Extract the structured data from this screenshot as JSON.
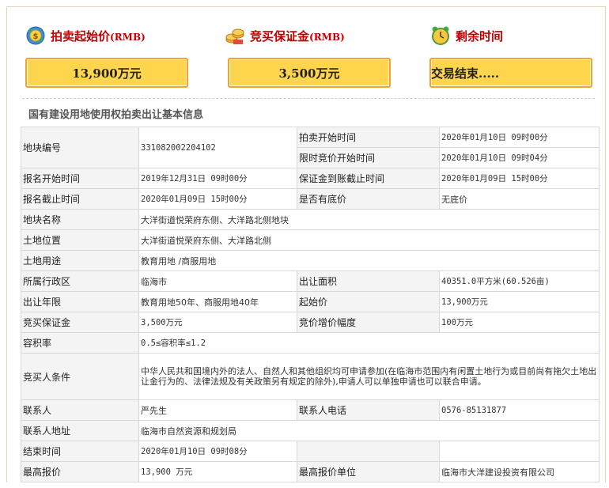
{
  "header": {
    "start_price_label": "拍卖起始价",
    "start_price_unit": "(RMB)",
    "start_price_value": "13,900万元",
    "deposit_label": "竞买保证金",
    "deposit_unit": "(RMB)",
    "deposit_value": "3,500万元",
    "remaining_label": "剩余时间",
    "remaining_value": "交易结束....."
  },
  "section_title": "国有建设用地使用权拍卖出让基本信息",
  "info": {
    "parcel_no_label": "地块编号",
    "parcel_no": "331082002204102",
    "auction_start_label": "拍卖开始时间",
    "auction_start": "2020年01月10日 09时00分",
    "timed_bid_start_label": "限时竞价开始时间",
    "timed_bid_start": "2020年01月10日 09时04分",
    "reg_start_label": "报名开始时间",
    "reg_start": "2019年12月31日 09时00分",
    "deposit_deadline_label": "保证金到账截止时间",
    "deposit_deadline": "2020年01月09日 15时00分",
    "reg_end_label": "报名截止时间",
    "reg_end": "2020年01月09日 15时00分",
    "reserve_label": "是否有底价",
    "reserve": "无底价",
    "name_label": "地块名称",
    "name": "大洋街道悦荣府东侧、大洋路北侧地块",
    "location_label": "土地位置",
    "location": "大洋街道悦荣府东侧、大洋路北侧",
    "use_label": "土地用途",
    "use": "教育用地 /商服用地",
    "district_label": "所属行政区",
    "district": "临海市",
    "area_label": "出让面积",
    "area": "40351.0平方米(60.526亩)",
    "term_label": "出让年限",
    "term": "教育用地50年、商服用地40年",
    "start_price_label": "起始价",
    "start_price": "13,900万元",
    "deposit_label": "竞买保证金",
    "deposit": "3,500万元",
    "increment_label": "竞价增价幅度",
    "increment": "100万元",
    "far_label": "容积率",
    "far": "0.5≤容积率≤1.2",
    "bidder_cond_label": "竞买人条件",
    "bidder_cond": "中华人民共和国境内外的法人、自然人和其他组织均可申请参加(在临海市范围内有闲置土地行为或目前尚有拖欠土地出让金行为的、法律法规及有关政策另有规定的除外),申请人可以单独申请也可以联合申请。",
    "contact_label": "联系人",
    "contact": "严先生",
    "phone_label": "联系人电话",
    "phone": "0576-85131877",
    "address_label": "联系人地址",
    "address": "临海市自然资源和规划局",
    "end_time_label": "结束时间",
    "end_time": "2020年01月10日 09时08分",
    "top_bid_label": "最高报价",
    "top_bid": "13,900 万元",
    "top_bidder_label": "最高报价单位",
    "top_bidder": "临海市大洋建设投资有限公司"
  },
  "icons": {
    "price": "money-refresh-icon",
    "deposit": "coins-icon",
    "clock": "alarm-clock-icon"
  },
  "colors": {
    "label_red": "#c00000",
    "box_fill": "#ffd54d",
    "box_border": "#f2a22f"
  }
}
